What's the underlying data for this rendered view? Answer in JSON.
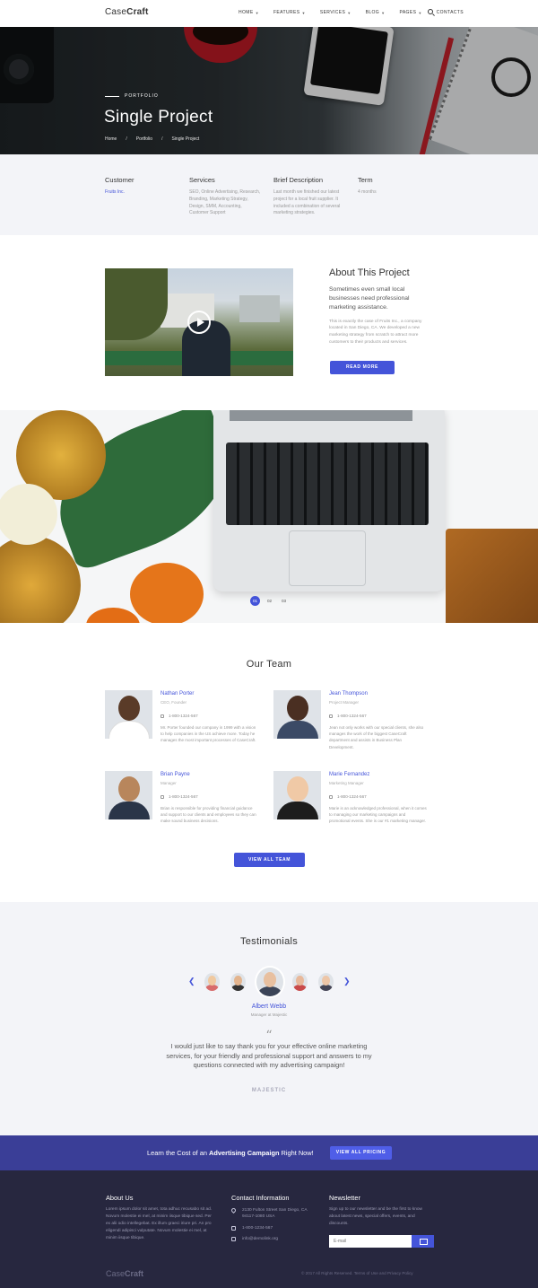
{
  "header": {
    "logo_pre": "Case",
    "logo_bold": "Craft",
    "nav": [
      {
        "label": "HOME",
        "has_menu": true
      },
      {
        "label": "FEATURES",
        "has_menu": true
      },
      {
        "label": "SERVICES",
        "has_menu": true
      },
      {
        "label": "BLOG",
        "has_menu": true
      },
      {
        "label": "PAGES",
        "has_menu": true
      },
      {
        "label": "CONTACTS",
        "has_menu": false
      }
    ],
    "search_icon": "search-icon"
  },
  "hero": {
    "kicker": "PORTFOLIO",
    "title": "Single Project",
    "breadcrumb": [
      "Home",
      "Portfolio",
      "Single Project"
    ],
    "breadcrumb_sep": "/"
  },
  "project_info": [
    {
      "heading": "Customer",
      "value": "Fruits Inc."
    },
    {
      "heading": "Services",
      "value": "SEO, Online Advertising, Research, Branding, Marketing Strategy, Design, SMM, Accounting, Customer Support"
    },
    {
      "heading": "Brief Description",
      "value": "Last month we finished our latest project for a local fruit supplier. It included a combination of several marketing strategies."
    },
    {
      "heading": "Term",
      "value": "4 months"
    }
  ],
  "about": {
    "title": "About This Project",
    "lead": "Sometimes even small local businesses need professional marketing assistance.",
    "body": "This is exactly the case of Fruits Inc., a company located in San Diego, CA. We developed a new marketing strategy from scratch to attract more customers to their products and services.",
    "button": "READ MORE"
  },
  "slider": {
    "pages": [
      "01",
      "02",
      "03"
    ],
    "active": 0
  },
  "team": {
    "title": "Our Team",
    "members": [
      {
        "name": "Nathan Porter",
        "role": "CEO, Founder",
        "phone": "1-800-1324-567",
        "desc": "Mr. Porter founded our company in 1999 with a vision to help companies in the US achieve more. Today he manages the most important processes of CaseCraft.",
        "skin": "#5a3b28",
        "suit": "#ffffff"
      },
      {
        "name": "Jean Thompson",
        "role": "Project Manager",
        "phone": "1-800-1324-567",
        "desc": "Jean not only works with our special clients, she also manages the work of the biggest CaseCraft department and assists in Business Plan Development.",
        "skin": "#4a2f22",
        "suit": "#3b4a66"
      },
      {
        "name": "Brian Payne",
        "role": "Manager",
        "phone": "1-800-1324-567",
        "desc": "Brian is responsible for providing financial guidance and support to our clients and employees so they can make sound business decisions.",
        "skin": "#b8865c",
        "suit": "#2a3548"
      },
      {
        "name": "Marie Fernandez",
        "role": "Marketing Manager",
        "phone": "1-800-1324-567",
        "desc": "Marie is an acknowledged professional, when it comes to managing our marketing campaigns and promotional events. She is our #1 marketing manager.",
        "skin": "#f0c9a6",
        "suit": "#1d1d1d"
      }
    ],
    "button": "VIEW ALL TEAM"
  },
  "testimonials": {
    "title": "Testimonials",
    "avatars": [
      {
        "skin": "#f0c9a0",
        "hair": "#c9933e"
      },
      {
        "skin": "#e3b48e",
        "hair": "#333333"
      },
      {
        "skin": "#e8c0a0",
        "hair": "#777777"
      },
      {
        "skin": "#e8b89a",
        "hair": "#3a2a20"
      },
      {
        "skin": "#edc6a8",
        "hair": "#5a4030"
      }
    ],
    "active_avatar": 2,
    "name": "Albert Webb",
    "role": "Manager at Majestic",
    "quote": "I would just like to say thank you for your effective online marketing services, for your friendly and professional support and answers to my questions connected with my advertising campaign!",
    "logo": "MAJESTIC"
  },
  "cta": {
    "text_pre": "Learn the Cost of an ",
    "text_bold": "Advertising Campaign",
    "text_post": " Right Now!",
    "button": "VIEW ALL PRICING"
  },
  "footer": {
    "about_title": "About Us",
    "about_body": "Lorem ipsum dolor sit amet, tota adhuc recusabo sit ad. Novum molestie ei mel, at minim iisque tibique sed. Per ex alii odio intellegebat. Ex illum graeci iriure pri. An pro eligendi adipisci vulputate. Novum molestie ei mel, at minim iisque tibique.",
    "contact_title": "Contact Information",
    "address": "2130 Fulton Street San Diego, CA 94117-1080 USA",
    "phone": "1-800-1234-567",
    "email": "info@demolink.org",
    "newsletter_title": "Newsletter",
    "newsletter_body": "Sign up to our newsletter and be the first to know about latest news, special offers, events, and discounts.",
    "email_placeholder": "E-mail",
    "logo_pre": "Case",
    "logo_bold": "Craft",
    "copyright": "© 2017 All Rights Reserved. Terms of Use and Privacy Policy"
  },
  "colors": {
    "accent": "#4454d9",
    "cta_bg": "#3a3e97",
    "footer_bg": "#27273f",
    "section_bg": "#f3f4f8"
  }
}
